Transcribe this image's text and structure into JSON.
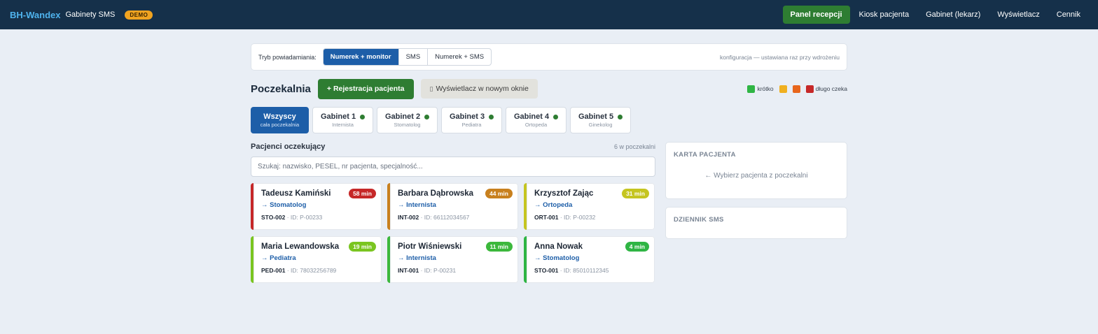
{
  "topbar": {
    "brand": "BH-Wandex",
    "brand_sub": "Gabinety SMS",
    "demo_badge": "DEMO",
    "nav": [
      {
        "label": "Panel recepcji"
      },
      {
        "label": "Kiosk pacjenta"
      },
      {
        "label": "Gabinet (lekarz)"
      },
      {
        "label": "Wyświetlacz"
      },
      {
        "label": "Cennik"
      }
    ]
  },
  "notify": {
    "label": "Tryb powiadamiania:",
    "modes": [
      "Numerek + monitor",
      "SMS",
      "Numerek + SMS"
    ],
    "config_note": "konfiguracja — ustawiana raz przy wdrożeniu"
  },
  "waiting": {
    "title": "Poczekalnia",
    "register_button": "+ Rejestracja pacjenta",
    "display_button": "Wyświetlacz w nowym oknie",
    "legend": [
      {
        "label": "krótko",
        "color": "#2fb544"
      },
      {
        "label": "",
        "color": "#f0b020"
      },
      {
        "label": "",
        "color": "#e8661c"
      },
      {
        "label": "długo czeka",
        "color": "#c62828"
      }
    ]
  },
  "tabs": [
    {
      "label": "Wszyscy",
      "sub": "cała poczekalnia"
    },
    {
      "label": "Gabinet 1",
      "sub": "Internista"
    },
    {
      "label": "Gabinet 2",
      "sub": "Stomatolog"
    },
    {
      "label": "Gabinet 3",
      "sub": "Pediatra"
    },
    {
      "label": "Gabinet 4",
      "sub": "Ortopeda"
    },
    {
      "label": "Gabinet 5",
      "sub": "Ginekolog"
    }
  ],
  "patients": {
    "title": "Pacjenci oczekujący",
    "count": "6 w poczekalni",
    "search_placeholder": "Szukaj: nazwisko, PESEL, nr pacjenta, specjalność...",
    "list": [
      {
        "name": "Tadeusz Kamiński",
        "spec": "→ Stomatolog",
        "code": "STO-002",
        "id": " · ID: P-00233",
        "wait": "58 min",
        "color": "#c62828"
      },
      {
        "name": "Barbara Dąbrowska",
        "spec": "→ Internista",
        "code": "INT-002",
        "id": " · ID: 66112034567",
        "wait": "44 min",
        "color": "#c8801e"
      },
      {
        "name": "Krzysztof Zając",
        "spec": "→ Ortopeda",
        "code": "ORT-001",
        "id": " · ID: P-00232",
        "wait": "31 min",
        "color": "#c5c520"
      },
      {
        "name": "Maria Lewandowska",
        "spec": "→ Pediatra",
        "code": "PED-001",
        "id": " · ID: 78032256789",
        "wait": "19 min",
        "color": "#7ac520"
      },
      {
        "name": "Piotr Wiśniewski",
        "spec": "→ Internista",
        "code": "INT-001",
        "id": " · ID: P-00231",
        "wait": "11 min",
        "color": "#3cb83c"
      },
      {
        "name": "Anna Nowak",
        "spec": "→ Stomatolog",
        "code": "STO-001",
        "id": " · ID: 85010112345",
        "wait": "4 min",
        "color": "#2fb544"
      }
    ]
  },
  "patient_card": {
    "title": "KARTA PACJENTA",
    "empty": "← Wybierz pacjenta z poczekalni"
  },
  "sms_log": {
    "title": "DZIENNIK SMS"
  }
}
